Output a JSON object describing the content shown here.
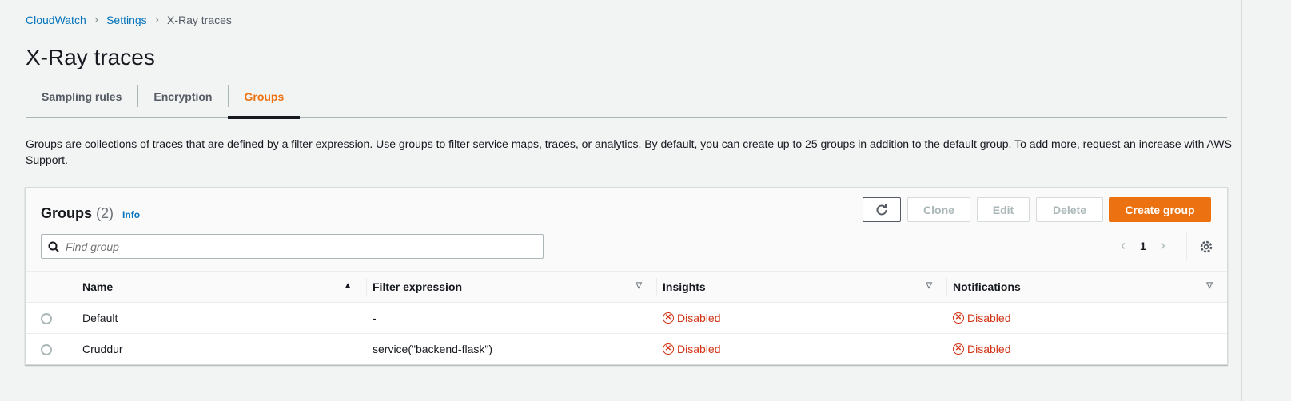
{
  "breadcrumb": [
    "CloudWatch",
    "Settings",
    "X-Ray traces"
  ],
  "page_title": "X-Ray traces",
  "tabs": [
    "Sampling rules",
    "Encryption",
    "Groups"
  ],
  "description": "Groups are collections of traces that are defined by a filter expression. Use groups to filter service maps, traces, or analytics. By default, you can create up to 25 groups in addition to the default group. To add more, request an increase with AWS Support.",
  "panel": {
    "title": "Groups",
    "count": "(2)",
    "info": "Info",
    "buttons": {
      "clone": "Clone",
      "edit": "Edit",
      "delete": "Delete",
      "create": "Create group"
    },
    "search_placeholder": "Find group",
    "page": "1"
  },
  "columns": [
    "Name",
    "Filter expression",
    "Insights",
    "Notifications"
  ],
  "rows": [
    {
      "name": "Default",
      "filter": "-",
      "insights": "Disabled",
      "notifications": "Disabled"
    },
    {
      "name": "Cruddur",
      "filter": "service(\"backend-flask\")",
      "insights": "Disabled",
      "notifications": "Disabled"
    }
  ],
  "colors": {
    "accent": "#ec7211",
    "link": "#0073bb",
    "error": "#d13212"
  }
}
